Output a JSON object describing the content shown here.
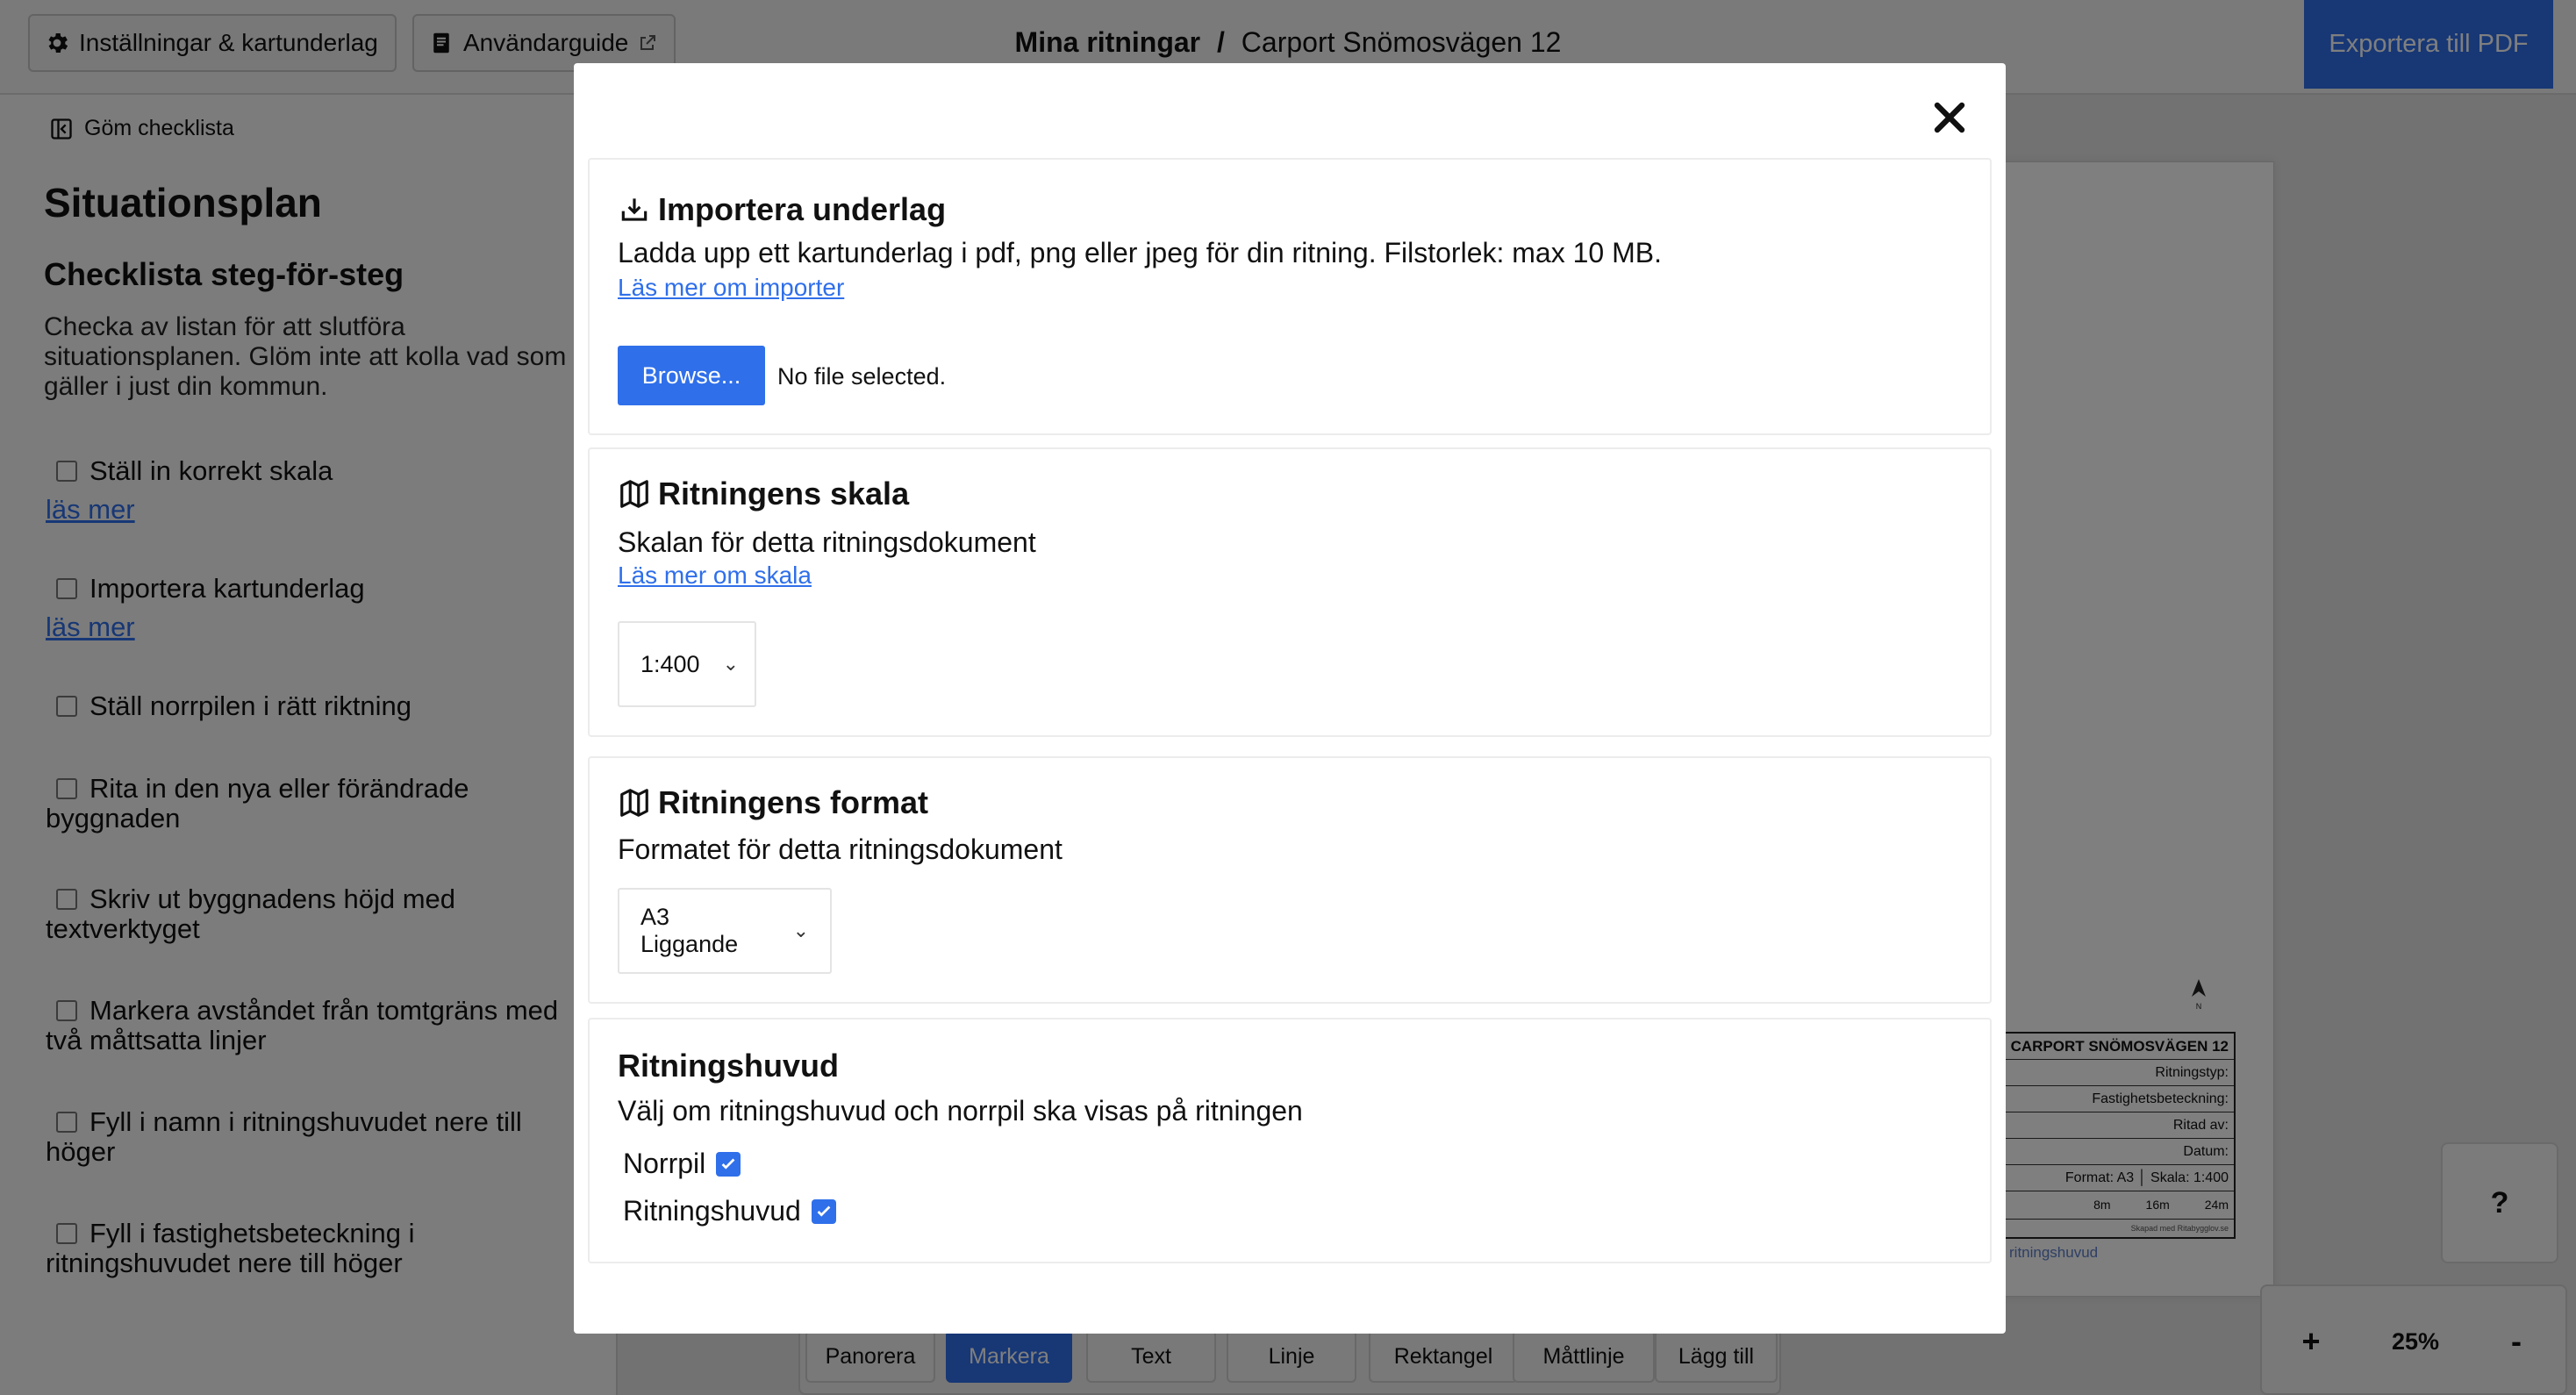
{
  "topbar": {
    "settings_label": "Inställningar & kartunderlag",
    "guide_label": "Användarguide",
    "breadcrumb_parent": "Mina ritningar",
    "breadcrumb_separator": "/",
    "breadcrumb_current": "Carport Snömosvägen 12",
    "export_label": "Exportera till PDF"
  },
  "sidebar": {
    "hide_label": "Göm checklista",
    "title": "Situationsplan",
    "subtitle": "Checklista steg-för-steg",
    "description": "Checka av listan för att slutföra situationsplanen. Glöm inte att kolla vad som gäller i just din kommun.",
    "items": [
      {
        "label": "Ställ in korrekt skala",
        "more": "läs mer"
      },
      {
        "label": "Importera kartunderlag",
        "more": "läs mer"
      },
      {
        "label": "Ställ norrpilen i rätt riktning",
        "more": ""
      },
      {
        "label": "Rita in den nya eller förändrade byggnaden",
        "more": ""
      },
      {
        "label": "Skriv ut byggnadens höjd med textverktyget",
        "more": ""
      },
      {
        "label": "Markera avståndet från tomtgräns med två måttsatta linjer",
        "more": ""
      },
      {
        "label": "Fyll i namn i ritningshuvudet nere till höger",
        "more": ""
      },
      {
        "label": "Fyll i fastighetsbeteckning i ritningshuvudet nere till höger",
        "more": ""
      }
    ]
  },
  "titleblock": {
    "heading": "CARPORT SNÖMOSVÄGEN 12",
    "type": "Ritningstyp:",
    "property": "Fastighetsbeteckning:",
    "drawn_by": "Ritad av:",
    "date": "Datum:",
    "format": "Format: A3 │ Skala: 1:400",
    "scale_8": "8m",
    "scale_16": "16m",
    "scale_24": "24m",
    "credit": "Skapad med Ritabygglov.se",
    "link": "ritningshuvud"
  },
  "toolbar": {
    "tools": [
      "Panorera",
      "Markera",
      "Text",
      "Linje",
      "Rektangel",
      "Måttlinje",
      "Lägg till"
    ],
    "active_tool": "Markera"
  },
  "help_label": "?",
  "zoom": {
    "plus": "+",
    "level": "25%",
    "minus": "-"
  },
  "modal": {
    "import": {
      "title": "Importera underlag",
      "description": "Ladda upp ett kartunderlag i pdf, png eller jpeg för din ritning. Filstorlek: max 10 MB.",
      "link": "Läs mer om importer",
      "browse_label": "Browse...",
      "file_status": "No file selected."
    },
    "scale": {
      "title": "Ritningens skala",
      "description": "Skalan för detta ritningsdokument",
      "link": "Läs mer om skala",
      "selected": "1:400"
    },
    "format": {
      "title": "Ritningens format",
      "description": "Formatet för detta ritningsdokument",
      "selected": "A3 Liggande"
    },
    "header": {
      "title": "Ritningshuvud",
      "description": "Välj om ritningshuvud och norrpil ska visas på ritningen",
      "options": [
        {
          "label": "Norrpil",
          "checked": true
        },
        {
          "label": "Ritningshuvud",
          "checked": true
        }
      ]
    }
  },
  "colors": {
    "accent": "#2f6fea",
    "overlay": "rgba(0,0,0,0.5)"
  }
}
